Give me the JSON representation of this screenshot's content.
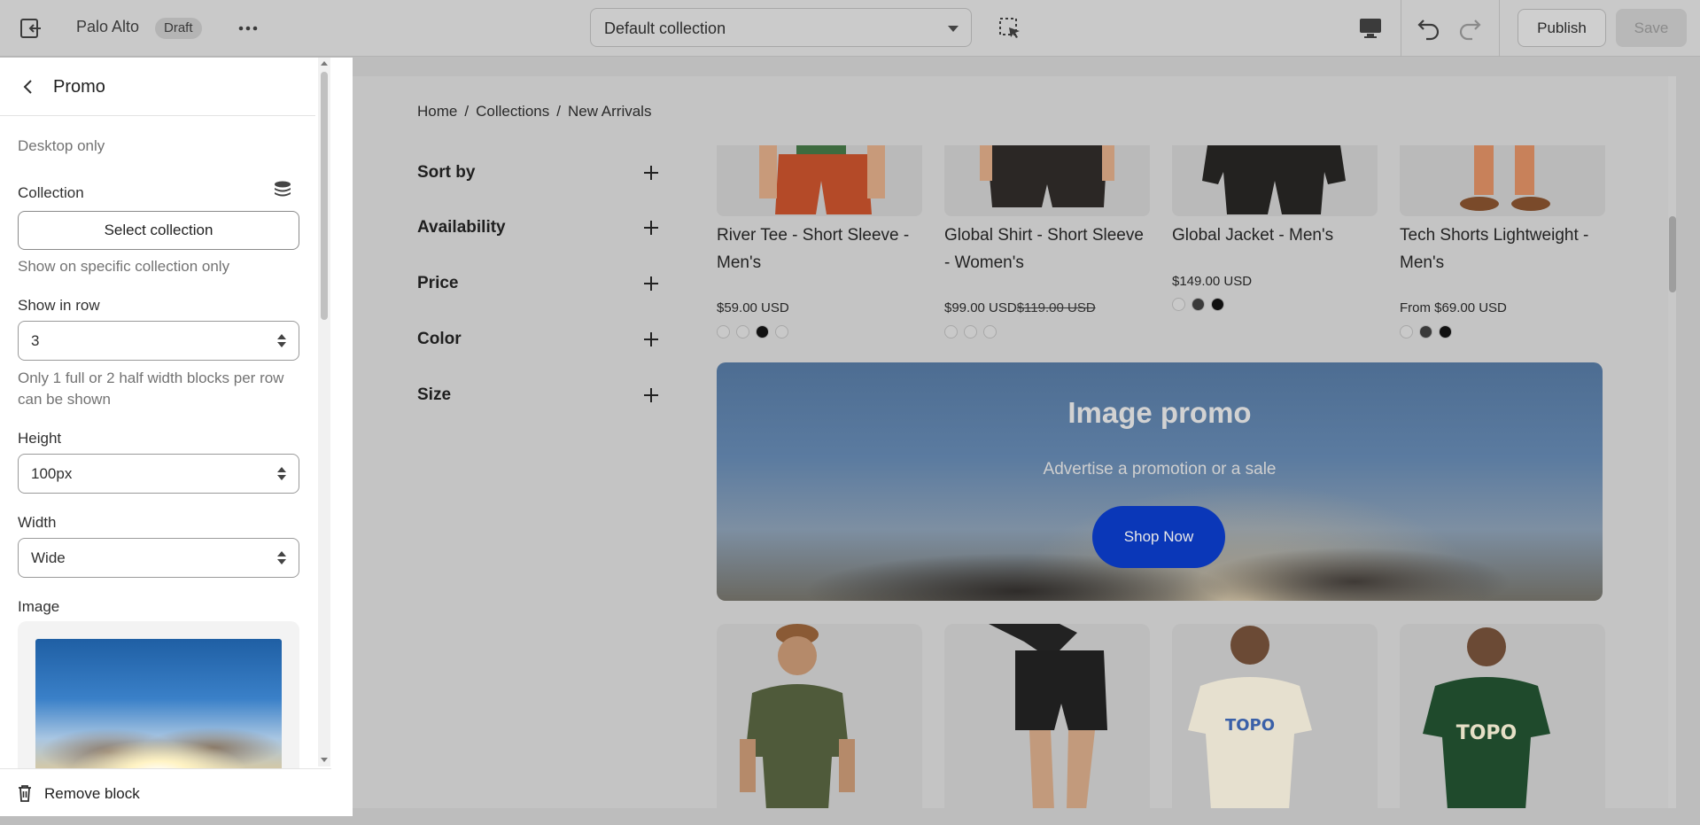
{
  "topbar": {
    "theme_name": "Palo Alto",
    "status_badge": "Draft",
    "collection_selector": "Default collection",
    "publish_label": "Publish",
    "save_label": "Save"
  },
  "sidebar": {
    "title": "Promo",
    "desktop_only": "Desktop only",
    "collection_label": "Collection",
    "select_collection_label": "Select collection",
    "collection_help": "Show on specific collection only",
    "show_in_row_label": "Show in row",
    "show_in_row_value": "3",
    "row_help": "Only 1 full or 2 half width blocks per row can be shown",
    "height_label": "Height",
    "height_value": "100px",
    "width_label": "Width",
    "width_value": "Wide",
    "image_label": "Image",
    "remove_block_label": "Remove block"
  },
  "preview": {
    "breadcrumb": [
      "Home",
      "Collections",
      "New Arrivals"
    ],
    "filters": [
      "Sort by",
      "Availability",
      "Price",
      "Color",
      "Size"
    ],
    "products": [
      {
        "name": "River Tee - Short Sleeve - Men's",
        "price": "$59.00 USD",
        "compare_price": "",
        "swatches": [
          "#c9c9c9",
          "#c9c9c9",
          "#111111",
          "#c9c9c9"
        ]
      },
      {
        "name": "Global Shirt - Short Sleeve - Women's",
        "price": "$99.00 USD",
        "compare_price": "$119.00 USD",
        "swatches": [
          "#c9c9c9",
          "#c9c9c9",
          "#c9c9c9"
        ]
      },
      {
        "name": "Global Jacket - Men's",
        "price": "$149.00 USD",
        "compare_price": "",
        "swatches": [
          "#c9c9c9",
          "#3a3a3a",
          "#111111"
        ]
      },
      {
        "name": "Tech Shorts Lightweight - Men's",
        "price": "From $69.00 USD",
        "compare_price": "",
        "swatches": [
          "#c9c9c9",
          "#3a3a3a",
          "#111111"
        ]
      }
    ],
    "promo": {
      "title": "Image promo",
      "subtitle": "Advertise a promotion or a sale",
      "button_label": "Shop Now"
    }
  },
  "colors": {
    "promo_button": "#0a37b8",
    "sidebar_bg": "#ffffff",
    "overlay_bg": "#c4c4c4"
  }
}
